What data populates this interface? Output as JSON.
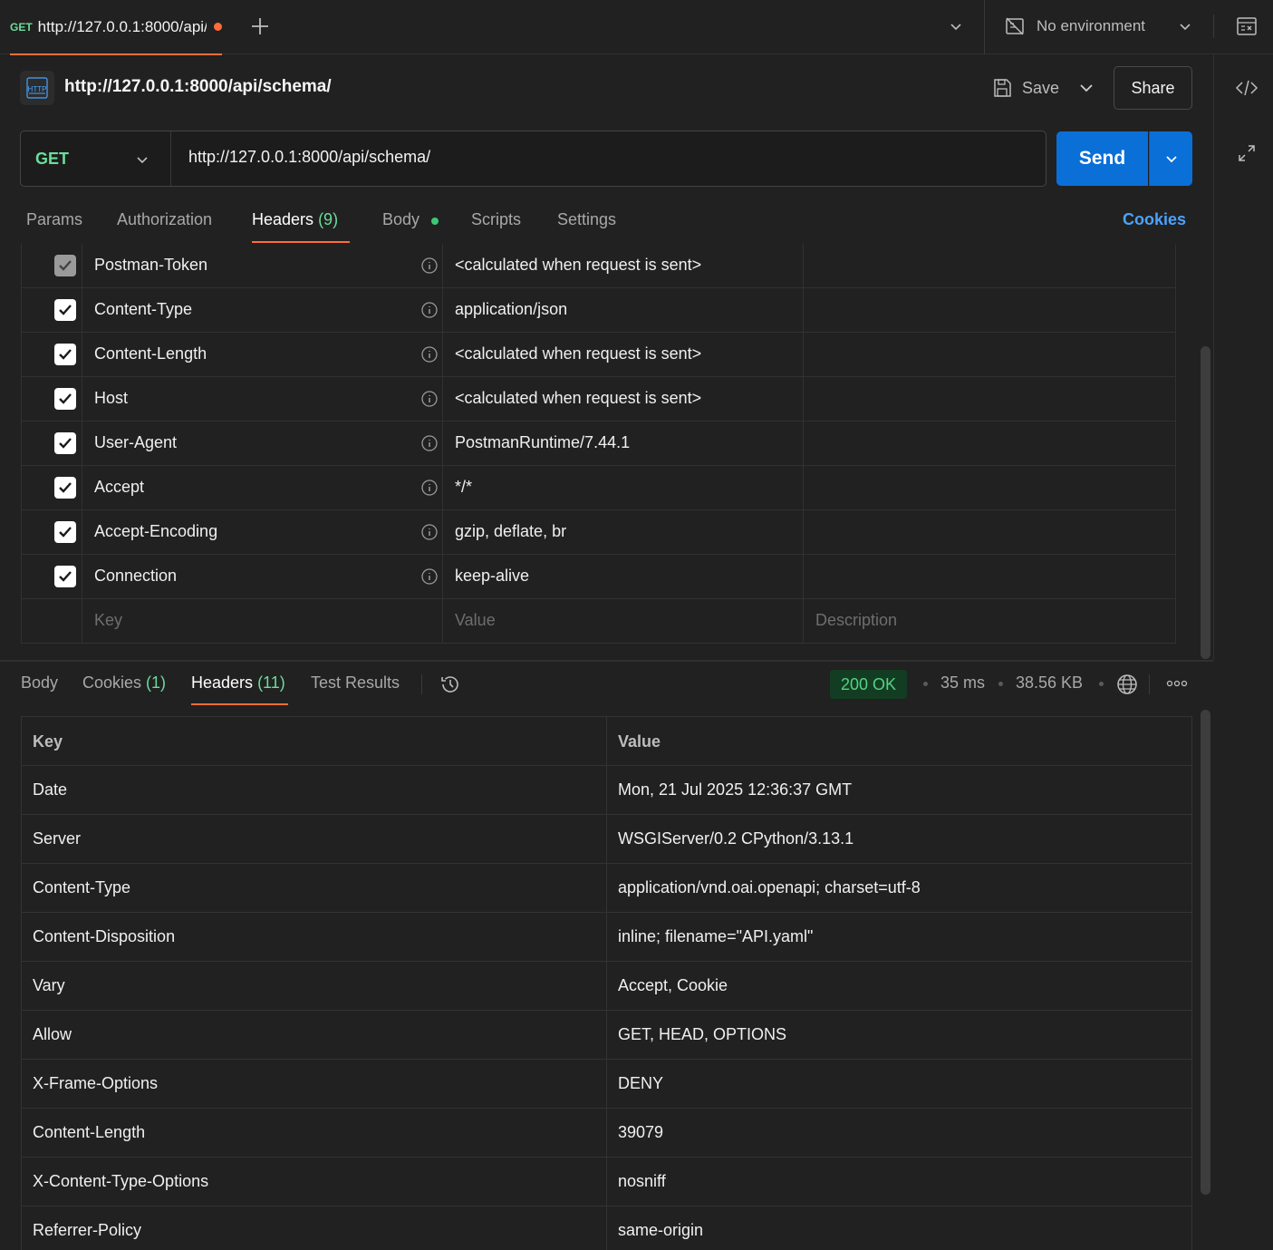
{
  "tab": {
    "method": "GET",
    "title": "http://127.0.0.1:8000/api/"
  },
  "environment": {
    "label": "No environment"
  },
  "request": {
    "title": "http://127.0.0.1:8000/api/schema/",
    "save_label": "Save",
    "share_label": "Share",
    "method": "GET",
    "url": "http://127.0.0.1:8000/api/schema/",
    "send_label": "Send"
  },
  "request_tabs": {
    "params": "Params",
    "authorization": "Authorization",
    "headers": "Headers",
    "headers_count": "(9)",
    "body": "Body",
    "scripts": "Scripts",
    "settings": "Settings",
    "cookies": "Cookies"
  },
  "request_headers": {
    "rows": [
      {
        "key": "Postman-Token",
        "value": "<calculated when request is sent>"
      },
      {
        "key": "Content-Type",
        "value": "application/json"
      },
      {
        "key": "Content-Length",
        "value": "<calculated when request is sent>"
      },
      {
        "key": "Host",
        "value": "<calculated when request is sent>"
      },
      {
        "key": "User-Agent",
        "value": "PostmanRuntime/7.44.1"
      },
      {
        "key": "Accept",
        "value": "*/*"
      },
      {
        "key": "Accept-Encoding",
        "value": "gzip, deflate, br"
      },
      {
        "key": "Connection",
        "value": "keep-alive"
      }
    ],
    "placeholder_key": "Key",
    "placeholder_value": "Value",
    "placeholder_description": "Description"
  },
  "response_tabs": {
    "body": "Body",
    "cookies": "Cookies",
    "cookies_count": "(1)",
    "headers": "Headers",
    "headers_count": "(11)",
    "test_results": "Test Results"
  },
  "response_meta": {
    "status": "200 OK",
    "time": "35 ms",
    "size": "38.56 KB"
  },
  "response_headers": {
    "col_key": "Key",
    "col_value": "Value",
    "rows": [
      {
        "key": "Date",
        "value": "Mon, 21 Jul 2025 12:36:37 GMT"
      },
      {
        "key": "Server",
        "value": "WSGIServer/0.2 CPython/3.13.1"
      },
      {
        "key": "Content-Type",
        "value": "application/vnd.oai.openapi; charset=utf-8"
      },
      {
        "key": "Content-Disposition",
        "value": "inline; filename=\"API.yaml\""
      },
      {
        "key": "Vary",
        "value": "Accept, Cookie"
      },
      {
        "key": "Allow",
        "value": "GET, HEAD, OPTIONS"
      },
      {
        "key": "X-Frame-Options",
        "value": "DENY"
      },
      {
        "key": "Content-Length",
        "value": "39079"
      },
      {
        "key": "X-Content-Type-Options",
        "value": "nosniff"
      },
      {
        "key": "Referrer-Policy",
        "value": "same-origin"
      }
    ]
  },
  "colors": {
    "accent": "#ff6c37",
    "send": "#0b6fd8",
    "get_method": "#6bdd9a",
    "link": "#4aa3ff",
    "status_ok": "#56d184"
  },
  "icons": [
    "plus-icon",
    "chevron-down-icon",
    "no-environment-icon",
    "environment-quicklook-icon",
    "http-icon",
    "save-icon",
    "code-icon",
    "expand-icon",
    "info-icon",
    "checkmark-icon",
    "history-icon",
    "globe-icon",
    "more-icon"
  ]
}
